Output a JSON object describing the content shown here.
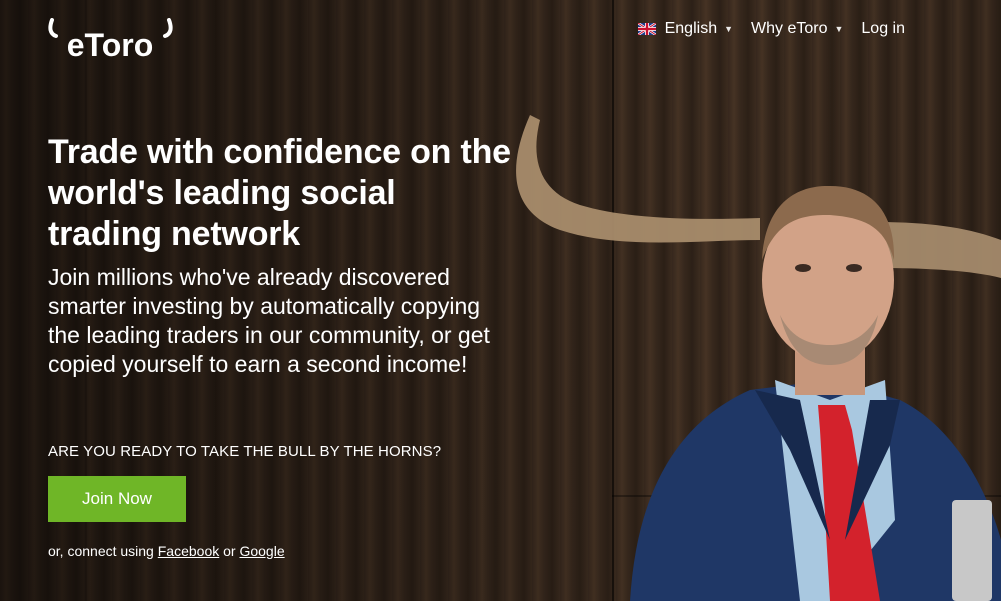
{
  "brand": {
    "logo_text": "eToro"
  },
  "nav": {
    "language_label": "English",
    "why_label": "Why eToro",
    "login_label": "Log in"
  },
  "hero": {
    "headline": "Trade with confidence on the world's leading social trading network",
    "subheading": "Join millions who've already discovered smarter investing by automatically copying the leading traders in our community, or get copied yourself to earn a second income!",
    "question": "ARE YOU READY TO TAKE THE BULL BY THE HORNS?",
    "join_label": "Join Now",
    "connect_prefix": "or, connect using",
    "facebook_label": "Facebook",
    "connect_or": "or",
    "google_label": "Google"
  },
  "colors": {
    "join_button": "#6fb627",
    "tie": "#d3222c",
    "suit": "#1f3766"
  },
  "icons": {
    "language_flag": "uk-flag-icon",
    "dropdown": "caret-down-icon"
  }
}
